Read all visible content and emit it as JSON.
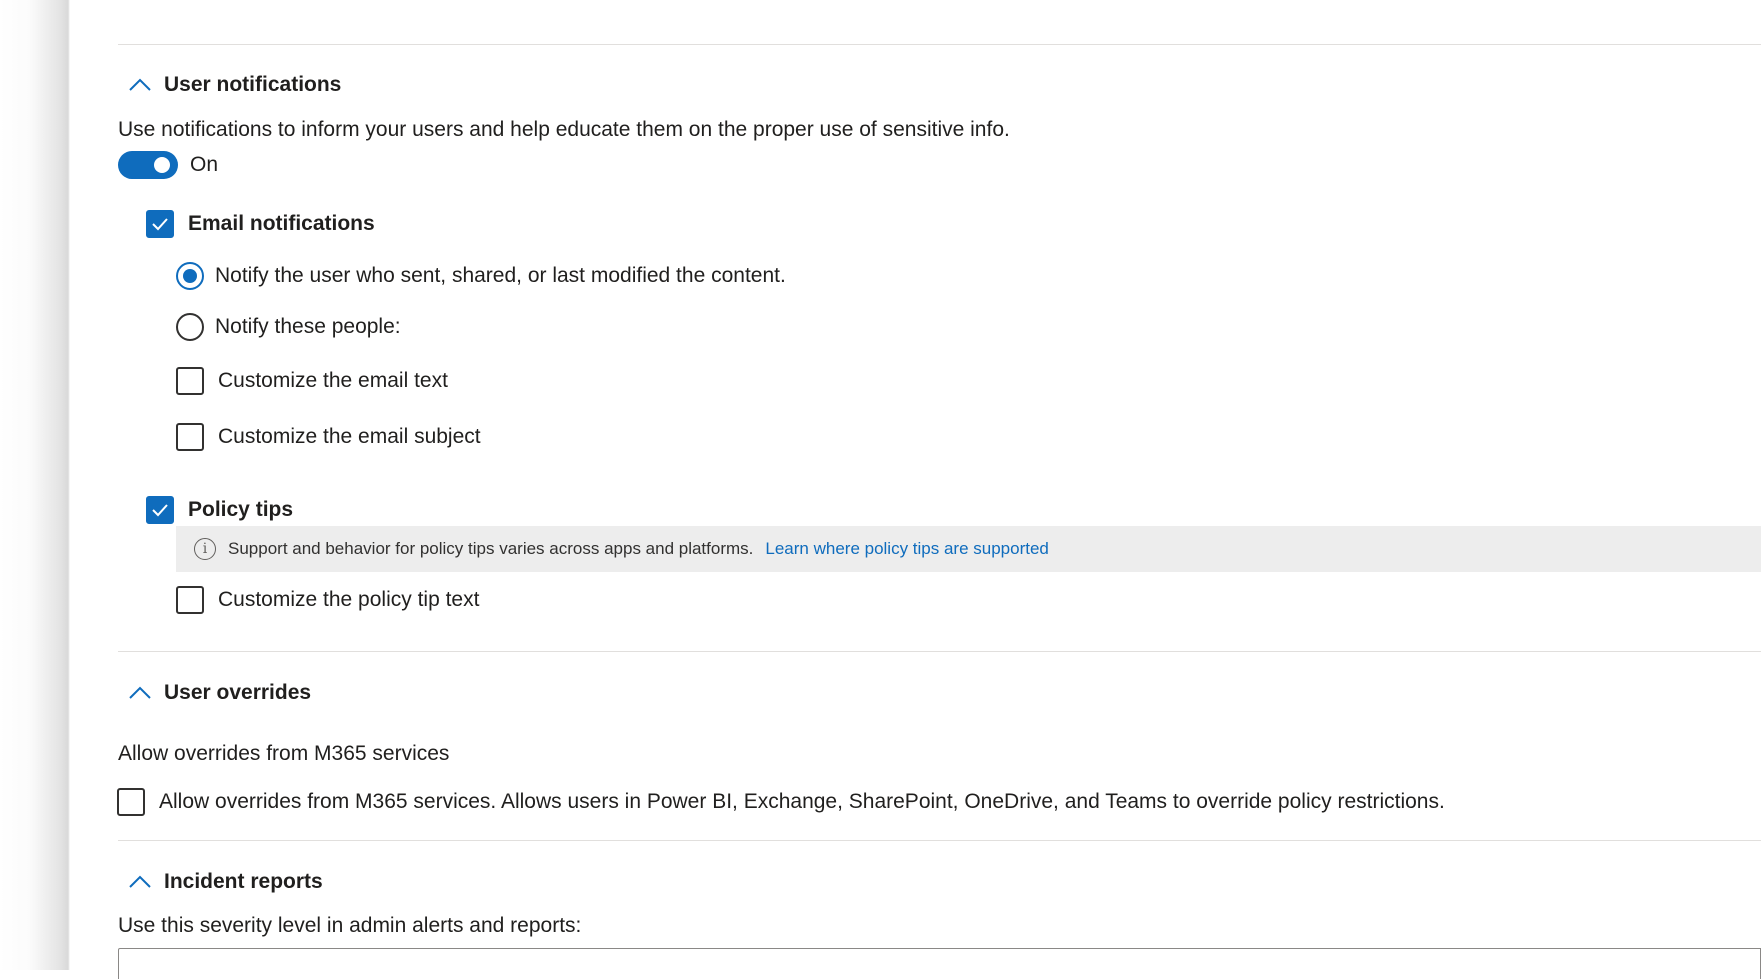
{
  "sections": {
    "user_notifications": {
      "title": "User notifications",
      "description": "Use notifications to inform your users and help educate them on the proper use of sensitive info.",
      "toggle_label": "On",
      "toggle_state": true,
      "email_notifications": {
        "label": "Email notifications",
        "checked": true,
        "radio_notify_sender": "Notify the user who sent, shared, or last modified the content.",
        "radio_notify_people": "Notify these people:",
        "customize_email_text": "Customize the email text",
        "customize_email_subject": "Customize the email subject"
      },
      "policy_tips": {
        "label": "Policy tips",
        "checked": true,
        "info_text": "Support and behavior for policy tips varies across apps and platforms.",
        "info_link": "Learn where policy tips are supported",
        "customize_tip_text": "Customize the policy tip text"
      }
    },
    "user_overrides": {
      "title": "User overrides",
      "subheading": "Allow overrides from M365 services",
      "checkbox_label": "Allow overrides from M365 services. Allows users in Power BI, Exchange, SharePoint, OneDrive, and Teams to override policy restrictions."
    },
    "incident_reports": {
      "title": "Incident reports",
      "severity_label": "Use this severity level in admin alerts and reports:"
    }
  },
  "colors": {
    "accent": "#0f6cbd",
    "text": "#201f1e",
    "divider": "#e1dfdd",
    "info_bar": "#ededed"
  },
  "icons": {
    "chevron": "chevron-up-icon",
    "check": "checkmark-icon",
    "info": "info-icon"
  }
}
